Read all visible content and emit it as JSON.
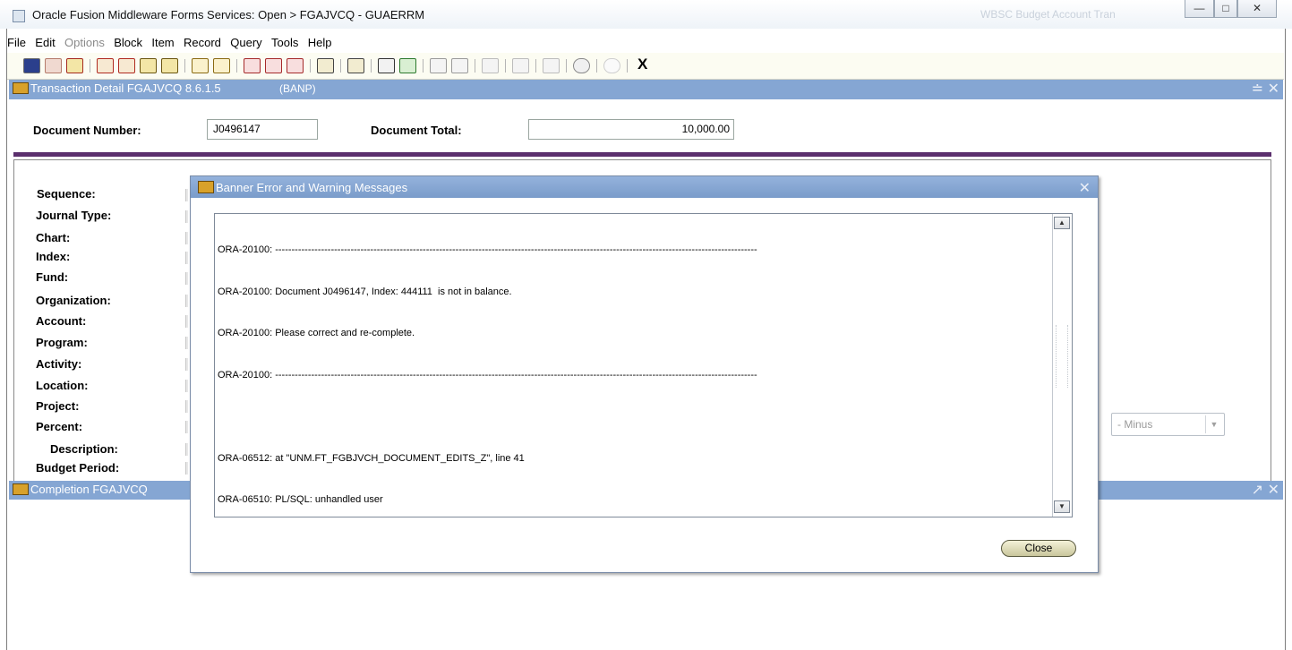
{
  "window": {
    "title": "Oracle Fusion Middleware Forms Services:  Open > FGAJVCQ - GUAERRM",
    "faded_title": "WBSC Budget Account Tran"
  },
  "menu": [
    "File",
    "Edit",
    "Options",
    "Block",
    "Item",
    "Record",
    "Query",
    "Tools",
    "Help"
  ],
  "toolbar": {
    "exit_label": "X"
  },
  "transaction_window": {
    "title": "Transaction Detail  FGAJVCQ  8.6.1.5",
    "instance": "(BANP)"
  },
  "header": {
    "document_number_label": "Document Number:",
    "document_number_value": "J0496147",
    "document_total_label": "Document Total:",
    "document_total_value": "10,000.00"
  },
  "fields": [
    "Sequence:",
    "Journal Type:",
    "Chart:",
    "Index:",
    "Fund:",
    "Organization:",
    "Account:",
    "Program:",
    "Activity:",
    "Location:",
    "Project:",
    "Percent:",
    "Description:",
    "Budget Period:"
  ],
  "minus_select": {
    "value": "- Minus"
  },
  "completion_window": {
    "title": "Completion  FGAJVCQ"
  },
  "dialog": {
    "title": "Banner Error and Warning Messages",
    "lines": [
      "ORA-20100: ---------------------------------------------------------------------------------------------------------------------------------------------------",
      "ORA-20100: Document J0496147, Index: 444111  is not in balance.",
      "ORA-20100: Please correct and re-complete.",
      "ORA-20100: ---------------------------------------------------------------------------------------------------------------------------------------------------",
      "",
      "ORA-06512: at \"UNM.FT_FGBJVCH_DOCUMENT_EDITS_Z\", line 41",
      "ORA-06510: PL/SQL: unhandled user"
    ],
    "close_label": "Close"
  }
}
